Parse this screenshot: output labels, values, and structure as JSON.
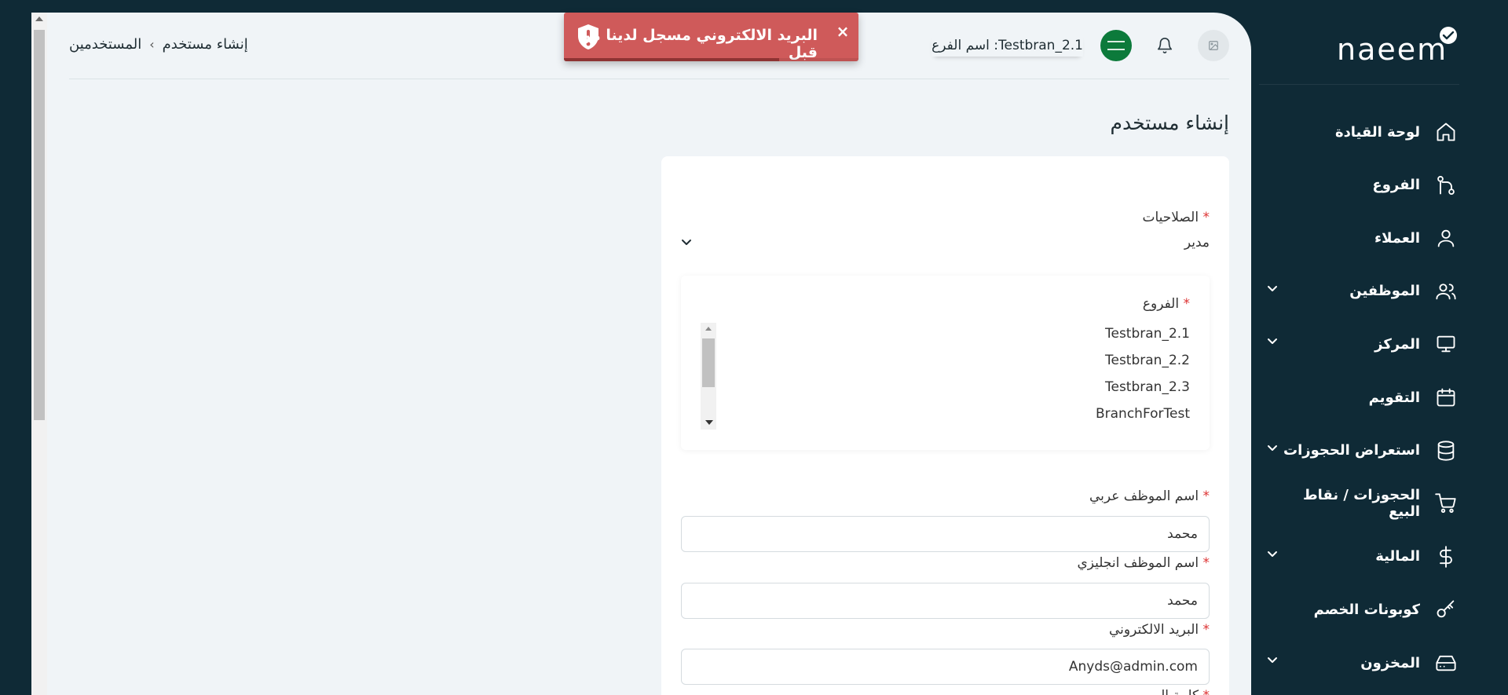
{
  "breadcrumb": {
    "parent": "المستخدمين",
    "current": "إنشاء مستخدم"
  },
  "header": {
    "branch_label": "اسم الفرع :Testbran_2.1"
  },
  "toast": {
    "message": "البريد الالكتروني مسجل لدينا من قبل",
    "close": "×",
    "progress": 0.73,
    "color": "#cf5a5a"
  },
  "page": {
    "title": "إنشاء مستخدم"
  },
  "form": {
    "permissions": {
      "label": "الصلاحيات",
      "required": "*",
      "value": "مدير"
    },
    "branches": {
      "label": "الفروع",
      "required": "*",
      "options": [
        "Testbran_2.1",
        "Testbran_2.2",
        "Testbran_2.3",
        "BranchForTest"
      ]
    },
    "name_ar": {
      "label": "اسم الموظف عربي",
      "required": "*",
      "value": "محمد"
    },
    "name_en": {
      "label": "اسم الموظف انجليزي",
      "required": "*",
      "value": "محمد"
    },
    "email": {
      "label": "البريد الالكتروني",
      "required": "*",
      "value": "Anyds@admin.com"
    },
    "password": {
      "label": "كلمة المرور",
      "required": "*"
    }
  },
  "sidebar": {
    "logo_text": "naeem",
    "items": [
      {
        "label": "لوحة القيادة",
        "icon": "home-icon",
        "has_chevron": false
      },
      {
        "label": "الفروع",
        "icon": "git-branch-icon",
        "has_chevron": false
      },
      {
        "label": "العملاء",
        "icon": "user-icon",
        "has_chevron": false
      },
      {
        "label": "الموظفين",
        "icon": "users-icon",
        "has_chevron": true
      },
      {
        "label": "المركز",
        "icon": "monitor-icon",
        "has_chevron": true
      },
      {
        "label": "التقويم",
        "icon": "calendar-icon",
        "has_chevron": false
      },
      {
        "label": "استعراض الحجوزات",
        "icon": "database-icon",
        "has_chevron": true
      },
      {
        "label": "الحجوزات / نقاط البيع",
        "icon": "cart-icon",
        "has_chevron": false
      },
      {
        "label": "المالية",
        "icon": "dollar-icon",
        "has_chevron": true
      },
      {
        "label": "كوبونات الخصم",
        "icon": "key-icon",
        "has_chevron": false
      },
      {
        "label": "المخزون",
        "icon": "hard-drive-icon",
        "has_chevron": true
      }
    ]
  },
  "colors": {
    "sidebar_bg": "#0f2a36",
    "content_bg": "#f0f4f7",
    "required": "#dd3333",
    "flag_green": "#0c7a3b"
  }
}
